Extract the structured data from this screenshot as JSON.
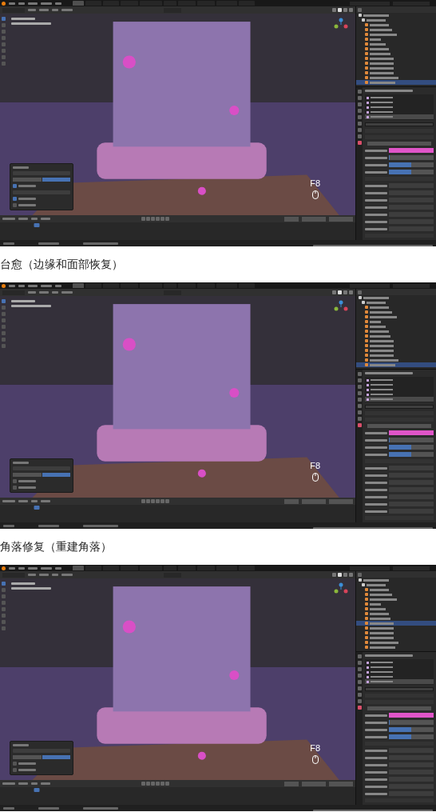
{
  "shots": [
    {
      "workspace_tabs": [
        {
          "selected": true
        },
        {
          "selected": false
        },
        {
          "selected": false
        },
        {
          "selected": false
        },
        {
          "selected": false
        },
        {
          "selected": false
        },
        {
          "selected": false
        },
        {
          "selected": false
        },
        {
          "selected": false
        },
        {
          "selected": false
        }
      ],
      "outliner_rows": [
        {
          "selected": false
        },
        {
          "selected": false
        },
        {
          "selected": false
        },
        {
          "selected": false
        },
        {
          "selected": false
        },
        {
          "selected": false
        },
        {
          "selected": false
        },
        {
          "selected": false
        },
        {
          "selected": false
        },
        {
          "selected": false
        },
        {
          "selected": false
        },
        {
          "selected": false
        },
        {
          "selected": false
        },
        {
          "selected": false
        },
        {
          "selected": true
        }
      ],
      "material_slots": [
        {
          "selected": false
        },
        {
          "selected": false
        },
        {
          "selected": false
        },
        {
          "selected": false
        },
        {
          "selected": true
        }
      ],
      "base_color": {
        "color": "#e055c8"
      },
      "sliders": [
        {
          "level": 0
        },
        {
          "level": 0.5
        },
        {
          "level": 0.5
        }
      ],
      "key_hint": "F8",
      "redo_rows": [
        {
          "kind": "field"
        },
        {
          "kind": "toggle",
          "options": [
            {
              "selected": false
            },
            {
              "selected": true
            }
          ]
        },
        {
          "kind": "check",
          "checked": true
        },
        {
          "kind": "field"
        },
        {
          "kind": "check",
          "checked": true
        },
        {
          "kind": "check",
          "checked": false
        }
      ],
      "playhead": {
        "level": 0.096
      }
    },
    {
      "workspace_tabs": [
        {
          "selected": true
        },
        {
          "selected": false
        },
        {
          "selected": false
        },
        {
          "selected": false
        },
        {
          "selected": false
        },
        {
          "selected": false
        },
        {
          "selected": false
        },
        {
          "selected": false
        },
        {
          "selected": false
        },
        {
          "selected": false
        }
      ],
      "outliner_rows": [
        {
          "selected": false
        },
        {
          "selected": false
        },
        {
          "selected": false
        },
        {
          "selected": false
        },
        {
          "selected": false
        },
        {
          "selected": false
        },
        {
          "selected": false
        },
        {
          "selected": false
        },
        {
          "selected": false
        },
        {
          "selected": false
        },
        {
          "selected": false
        },
        {
          "selected": false
        },
        {
          "selected": false
        },
        {
          "selected": false
        },
        {
          "selected": true
        }
      ],
      "material_slots": [
        {
          "selected": false
        },
        {
          "selected": false
        },
        {
          "selected": false
        },
        {
          "selected": false
        },
        {
          "selected": true
        }
      ],
      "base_color": {
        "color": "#e055c8"
      },
      "sliders": [
        {
          "level": 0
        },
        {
          "level": 0.5
        },
        {
          "level": 0.5
        }
      ],
      "key_hint": "F8",
      "redo_rows": [
        {
          "kind": "field"
        },
        {
          "kind": "toggle",
          "options": [
            {
              "selected": false
            },
            {
              "selected": true
            }
          ]
        },
        {
          "kind": "check",
          "checked": false
        },
        {
          "kind": "check",
          "checked": false
        }
      ],
      "playhead": {
        "level": 0.096
      }
    },
    {
      "workspace_tabs": [
        {
          "selected": true
        },
        {
          "selected": false
        },
        {
          "selected": false
        },
        {
          "selected": false
        },
        {
          "selected": false
        },
        {
          "selected": false
        },
        {
          "selected": false
        },
        {
          "selected": false
        },
        {
          "selected": false
        },
        {
          "selected": false
        }
      ],
      "outliner_rows": [
        {
          "selected": false
        },
        {
          "selected": false
        },
        {
          "selected": false
        },
        {
          "selected": false
        },
        {
          "selected": false
        },
        {
          "selected": false
        },
        {
          "selected": false
        },
        {
          "selected": false
        },
        {
          "selected": false
        },
        {
          "selected": true
        },
        {
          "selected": false
        },
        {
          "selected": false
        },
        {
          "selected": false
        },
        {
          "selected": false
        },
        {
          "selected": false
        }
      ],
      "material_slots": [
        {
          "selected": false
        },
        {
          "selected": false
        },
        {
          "selected": false
        },
        {
          "selected": false
        },
        {
          "selected": true
        }
      ],
      "base_color": {
        "color": "#e055c8"
      },
      "sliders": [
        {
          "level": 0
        },
        {
          "level": 0.5
        },
        {
          "level": 0.5
        }
      ],
      "key_hint": "F8",
      "redo_rows": [
        {
          "kind": "field"
        },
        {
          "kind": "toggle",
          "options": [
            {
              "selected": false
            },
            {
              "selected": true
            }
          ]
        },
        {
          "kind": "check",
          "checked": false
        },
        {
          "kind": "check",
          "checked": false
        }
      ],
      "playhead": {
        "level": 0.096
      }
    }
  ],
  "captions": [
    "台愈（边缘和面部恢复）",
    "角落修复（重建角落）"
  ]
}
